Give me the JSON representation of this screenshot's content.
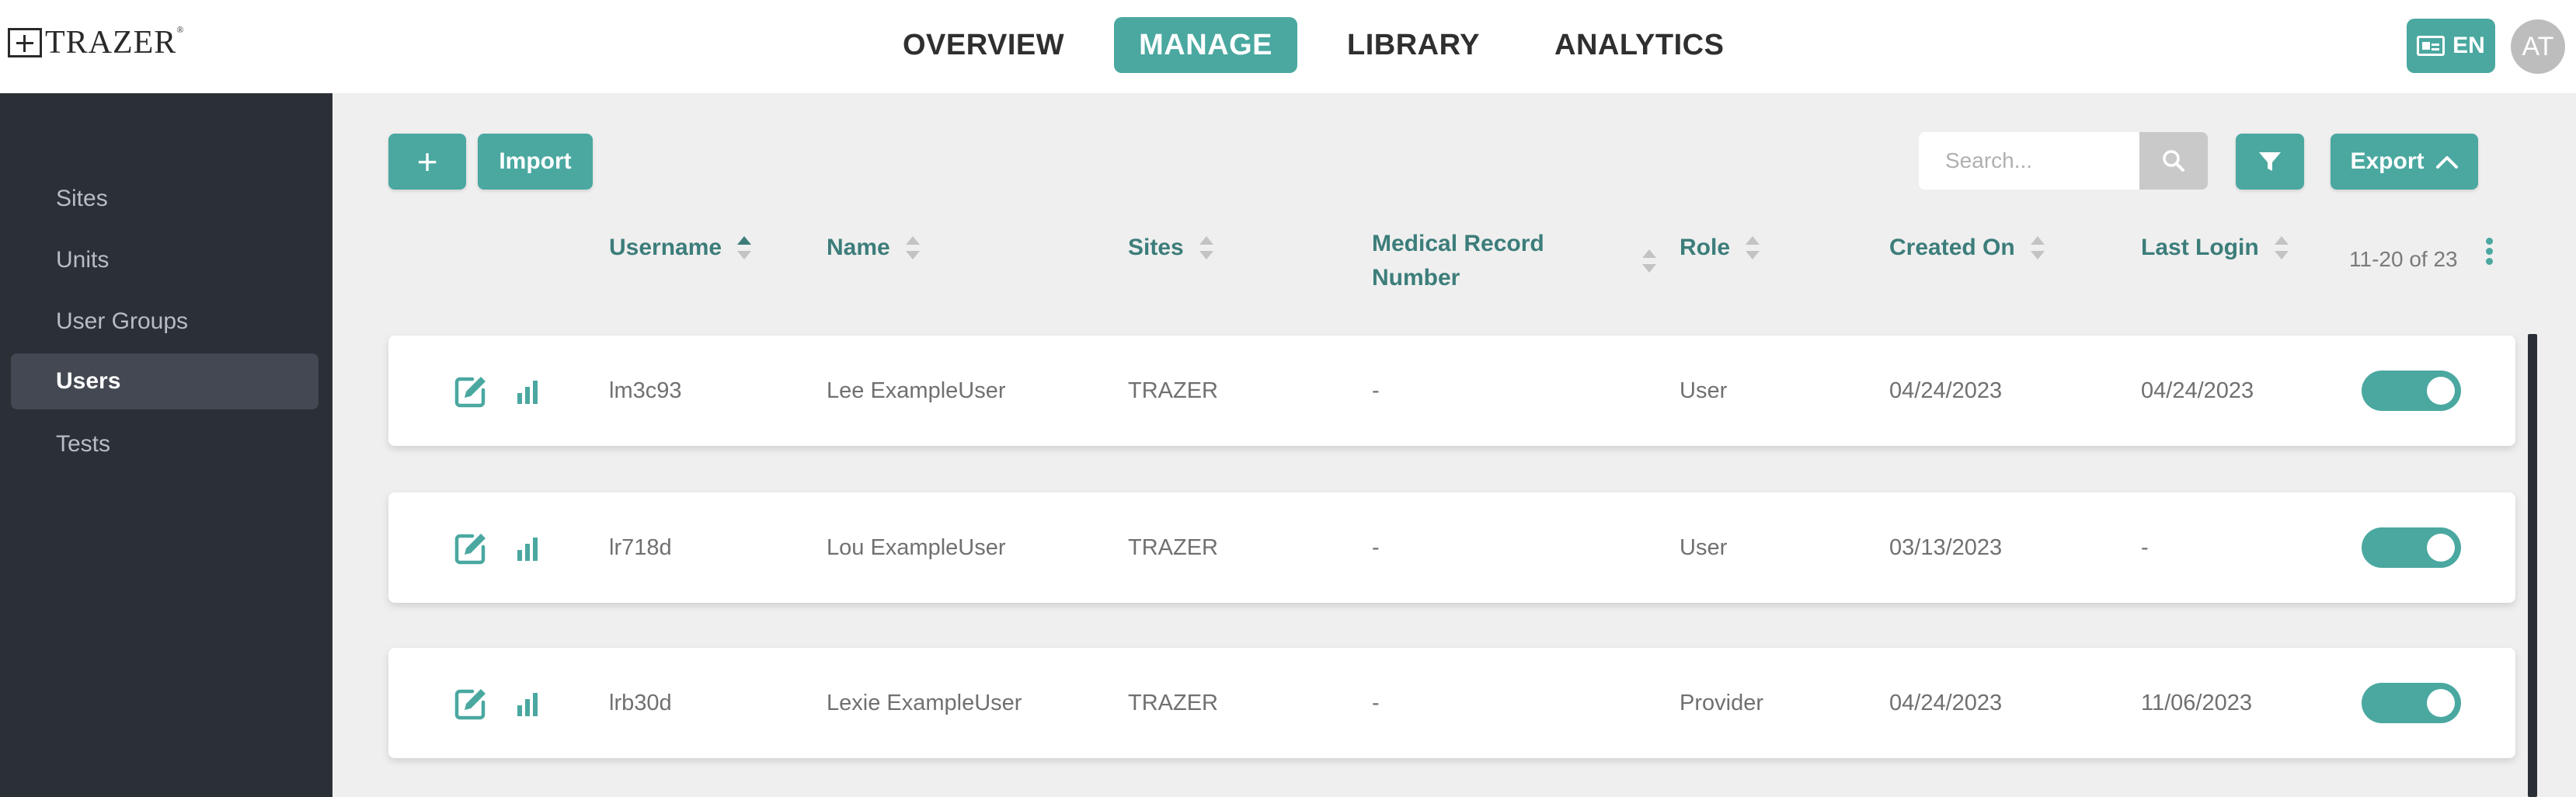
{
  "brand": {
    "name": "TRAZER",
    "reg": "®"
  },
  "nav": {
    "tabs": [
      {
        "label": "OVERVIEW",
        "active": false
      },
      {
        "label": "MANAGE",
        "active": true
      },
      {
        "label": "LIBRARY",
        "active": false
      },
      {
        "label": "ANALYTICS",
        "active": false
      }
    ],
    "language": "EN",
    "avatar_initials": "AT"
  },
  "sidebar": {
    "items": [
      {
        "label": "Sites",
        "active": false
      },
      {
        "label": "Units",
        "active": false
      },
      {
        "label": "User Groups",
        "active": false
      },
      {
        "label": "Users",
        "active": true
      },
      {
        "label": "Tests",
        "active": false
      }
    ]
  },
  "toolbar": {
    "add_label": "+",
    "import_label": "Import",
    "search_placeholder": "Search...",
    "export_label": "Export"
  },
  "table": {
    "columns": {
      "username": "Username",
      "name": "Name",
      "sites": "Sites",
      "mrn_line1": "Medical Record",
      "mrn_line2": "Number",
      "role": "Role",
      "created_on": "Created On",
      "last_login": "Last Login"
    },
    "sorted_by": "username",
    "sort_direction": "ascending",
    "pager": "11-20 of 23",
    "rows": [
      {
        "username": "lm3c93",
        "name": "Lee ExampleUser",
        "sites": "TRAZER",
        "mrn": "-",
        "role": "User",
        "created_on": "04/24/2023",
        "last_login": "04/24/2023",
        "enabled": true
      },
      {
        "username": "lr718d",
        "name": "Lou ExampleUser",
        "sites": "TRAZER",
        "mrn": "-",
        "role": "User",
        "created_on": "03/13/2023",
        "last_login": "-",
        "enabled": true
      },
      {
        "username": "lrb30d",
        "name": "Lexie ExampleUser",
        "sites": "TRAZER",
        "mrn": "-",
        "role": "Provider",
        "created_on": "04/24/2023",
        "last_login": "11/06/2023",
        "enabled": true
      }
    ]
  },
  "colors": {
    "accent": "#4aa8a0",
    "sidebar_bg": "#2b2f36",
    "header_text": "#3c7d7a"
  }
}
